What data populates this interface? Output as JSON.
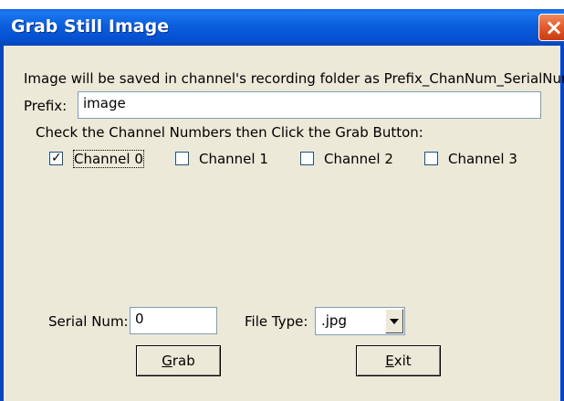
{
  "window": {
    "title": "Grab Still Image",
    "close_glyph": "×"
  },
  "dialog": {
    "info_text": "Image will be saved in channel's recording folder as Prefix_ChanNum_SerialNum:",
    "prefix_label": "Prefix:",
    "prefix_value": "image",
    "instruction_text": "Check the Channel Numbers then Click the Grab Button:",
    "channels": [
      {
        "label": "Channel 0",
        "checked": true
      },
      {
        "label": "Channel 1",
        "checked": false
      },
      {
        "label": "Channel 2",
        "checked": false
      },
      {
        "label": "Channel 3",
        "checked": false
      }
    ],
    "serial_label": "Serial Num:",
    "serial_value": "0",
    "filetype_label": "File Type:",
    "filetype_value": ".jpg",
    "grab_access_key": "G",
    "grab_rest": "rab",
    "exit_access_key": "E",
    "exit_rest": "xit"
  },
  "colors": {
    "titlebar": "#0b5fdc",
    "dialog_bg": "#ece9d8",
    "close_button": "#e25a2b"
  },
  "icons": {
    "close": "close-icon",
    "check": "check-mark-icon",
    "dropdown": "chevron-down-icon"
  }
}
